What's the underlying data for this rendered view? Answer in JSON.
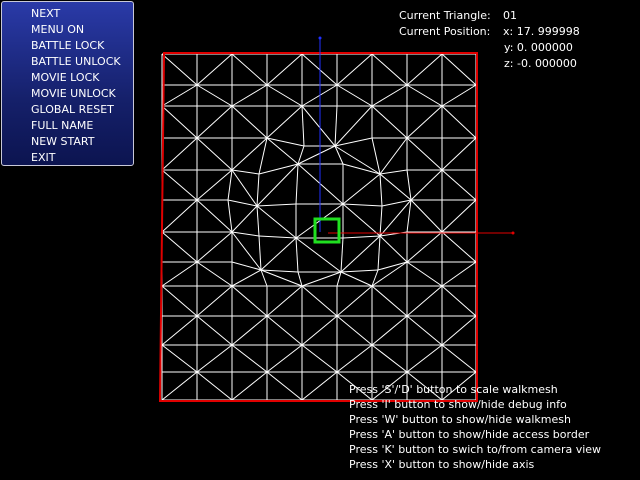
{
  "menu": {
    "items": [
      "NEXT",
      "MENU ON",
      "BATTLE LOCK",
      "BATTLE UNLOCK",
      "MOVIE LOCK",
      "MOVIE UNLOCK",
      "GLOBAL RESET",
      "FULL NAME",
      "NEW START",
      "EXIT"
    ]
  },
  "info": {
    "triangle_label": "Current Triangle:",
    "triangle_value": "01",
    "position_label": "Current Position:",
    "x": "x: 17. 999998",
    "y": "y: 0. 000000",
    "z": "z: -0. 000000"
  },
  "help": [
    "Press 'S'/'D' button to scale walkmesh",
    "Press 'I' button to show/hide debug info",
    "Press 'W' button to show/hide walkmesh",
    "Press 'A' button to show/hide access border",
    "Press 'K' button to swich to/from camera view",
    "Press 'X' button to show/hide axis"
  ],
  "colors": {
    "mesh": "#ffffff",
    "border": "#e00000",
    "axis_x": "#e00000",
    "axis_y": "#2030ff",
    "cursor": "#20e020"
  }
}
